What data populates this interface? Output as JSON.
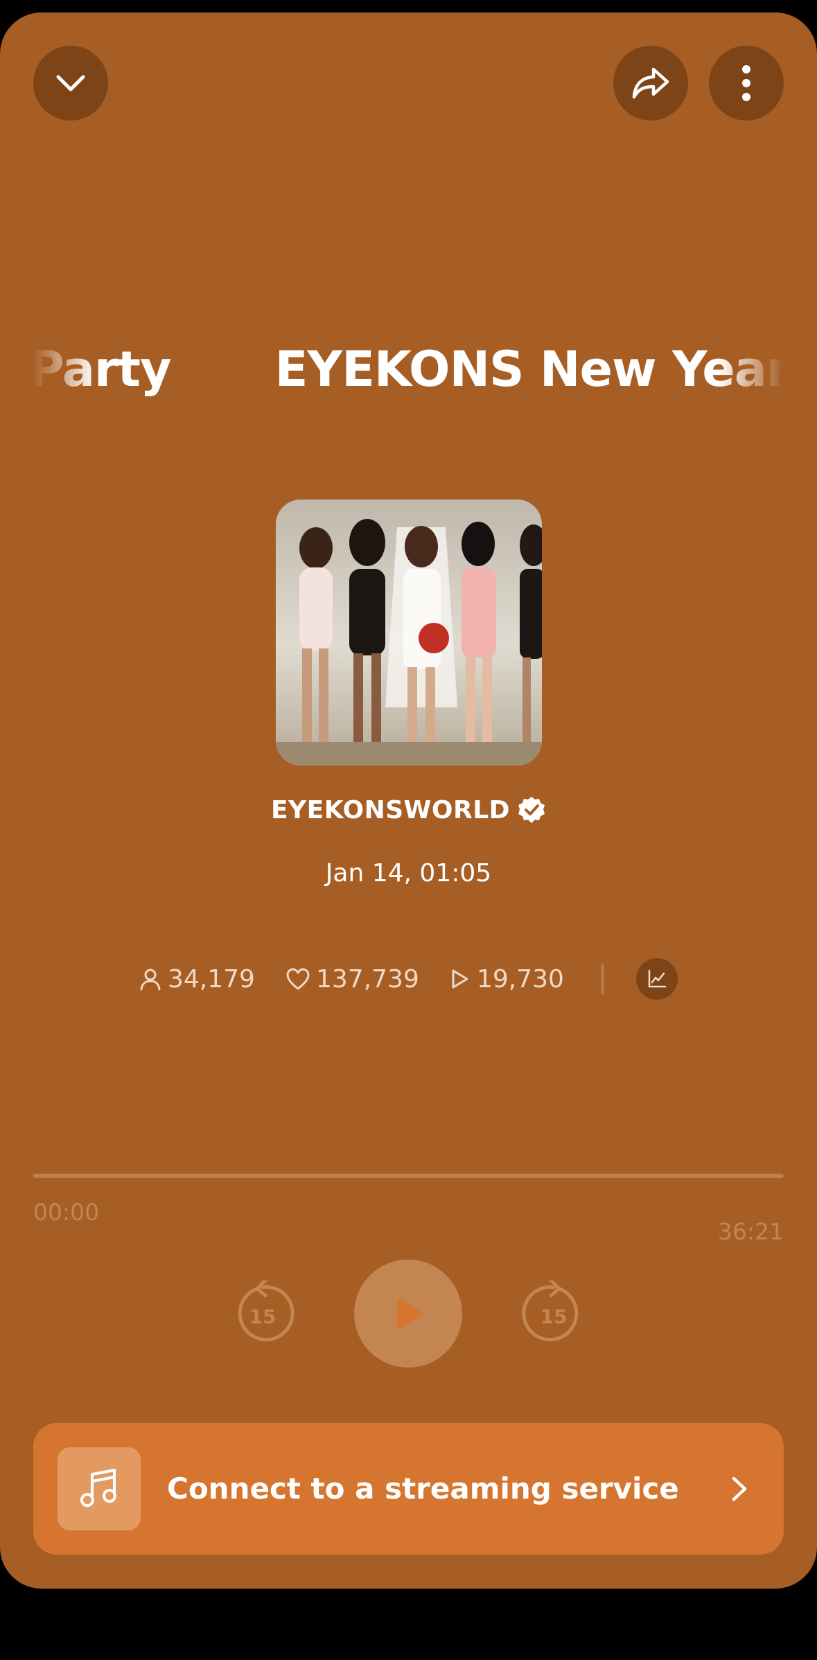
{
  "header": {
    "collapse_icon": "chevron-down-icon",
    "share_icon": "share-arrow-icon",
    "more_icon": "vertical-dots-icon"
  },
  "title_marquee": {
    "segments": [
      "ng Party",
      "EYEKONS New Year"
    ]
  },
  "episode": {
    "artist": "EYEKONSWORLD",
    "verified_icon": "verified-badge-icon",
    "date": "Jan 14, 01:05"
  },
  "stats": {
    "listeners": "34,179",
    "likes": "137,739",
    "plays": "19,730",
    "listeners_icon": "person-icon",
    "likes_icon": "heart-icon",
    "plays_icon": "play-outline-icon",
    "chart_icon": "trend-chart-icon"
  },
  "player": {
    "elapsed": "00:00",
    "duration": "36:21",
    "progress_fraction": 0,
    "skip_back_seconds": "15",
    "skip_forward_seconds": "15"
  },
  "connect_banner": {
    "label": "Connect to a streaming service",
    "icon": "music-note-icon"
  },
  "colors": {
    "background": "#a65e25",
    "button_dark": "#7d4418",
    "accent": "#d6752f",
    "play_button": "#c38552"
  }
}
